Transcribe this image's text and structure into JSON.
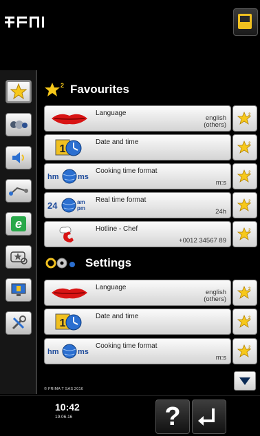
{
  "sections": {
    "favourites": {
      "title": "Favourites"
    },
    "settings": {
      "title": "Settings"
    }
  },
  "favourites_items": [
    {
      "label": "Language",
      "value_line1": "english",
      "value_line2": "(others)",
      "icon": "lips-icon"
    },
    {
      "label": "Date and time",
      "value_line1": "",
      "value_line2": "",
      "icon": "calendar-clock-icon"
    },
    {
      "label": "Cooking time format",
      "value_line1": "",
      "value_line2": "m:s",
      "icon": "hm-ms-globe-icon"
    },
    {
      "label": "Real time format",
      "value_line1": "",
      "value_line2": "24h",
      "icon": "24-ampm-globe-icon"
    },
    {
      "label": "Hotline - Chef",
      "value_line1": "",
      "value_line2": "+0012 34567 89",
      "icon": "phone-chef-icon"
    }
  ],
  "settings_items": [
    {
      "label": "Language",
      "value_line1": "english",
      "value_line2": "(others)",
      "icon": "lips-icon"
    },
    {
      "label": "Date and time",
      "value_line1": "",
      "value_line2": "",
      "icon": "calendar-clock-icon"
    },
    {
      "label": "Cooking time format",
      "value_line1": "",
      "value_line2": "m:s",
      "icon": "hm-ms-globe-icon"
    }
  ],
  "icon_text": {
    "calendar_number": "1",
    "hm": "hm",
    "ms": "ms",
    "h24": "24",
    "am": "am",
    "pm": "pm"
  },
  "footer": {
    "copyright": "© FRIMA T SAS 2016",
    "time": "10:42",
    "date": "19.06.16",
    "help_label": "?"
  },
  "colors": {
    "accent_yellow": "#f0c020",
    "globe_blue": "#2b6fd0",
    "star_yellow": "#f7c81a"
  }
}
